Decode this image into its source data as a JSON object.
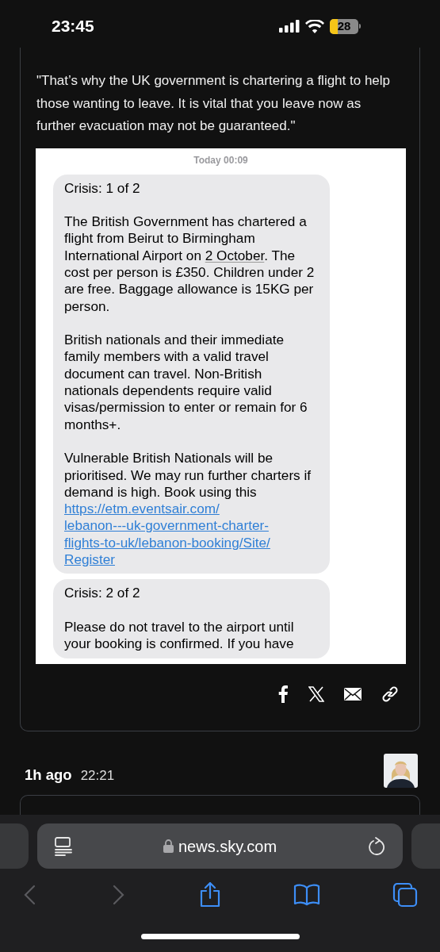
{
  "status_bar": {
    "time": "23:45",
    "battery": "28"
  },
  "article": {
    "quote": "\"That’s why the UK government is chartering a flight to help those wanting to leave. It is vital that you leave now as further evacuation may not be guaranteed.\"",
    "message_screenshot": {
      "timestamp": "Today 00:09",
      "messages": [
        {
          "paragraphs": [
            [
              {
                "kind": "plain",
                "text": "Crisis: 1 of 2"
              }
            ],
            [
              {
                "kind": "plain",
                "text": "The British Government has chartered a flight from Beirut to Birmingham International Airport on "
              },
              {
                "kind": "date",
                "text": "2 October"
              },
              {
                "kind": "plain",
                "text": ". The cost per person is £350. Children under 2 are free. Baggage allowance is 15KG per person."
              }
            ],
            [
              {
                "kind": "plain",
                "text": "British nationals and their immediate family members with a valid travel document can travel. Non-British nationals dependents require valid visas/permission to enter or remain for 6 months+."
              }
            ],
            [
              {
                "kind": "plain",
                "text": "Vulnerable British Nationals will be prioritised. We may run further charters if demand is high. Book using this "
              },
              {
                "kind": "link",
                "text": "https://etm.eventsair.com/"
              },
              {
                "kind": "link",
                "text": "lebanon---uk-government-charter-"
              },
              {
                "kind": "link",
                "text": "flights-to-uk/lebanon-booking/Site/"
              },
              {
                "kind": "link",
                "text": "Register"
              }
            ]
          ]
        },
        {
          "paragraphs": [
            [
              {
                "kind": "plain",
                "text": "Crisis: 2 of 2"
              }
            ],
            [
              {
                "kind": "plain",
                "text": "Please do not travel to the airport until your booking is confirmed. If you have"
              }
            ]
          ]
        }
      ]
    }
  },
  "post": {
    "age": "1h ago",
    "time": "22:21"
  },
  "browser": {
    "url": "news.sky.com"
  }
}
